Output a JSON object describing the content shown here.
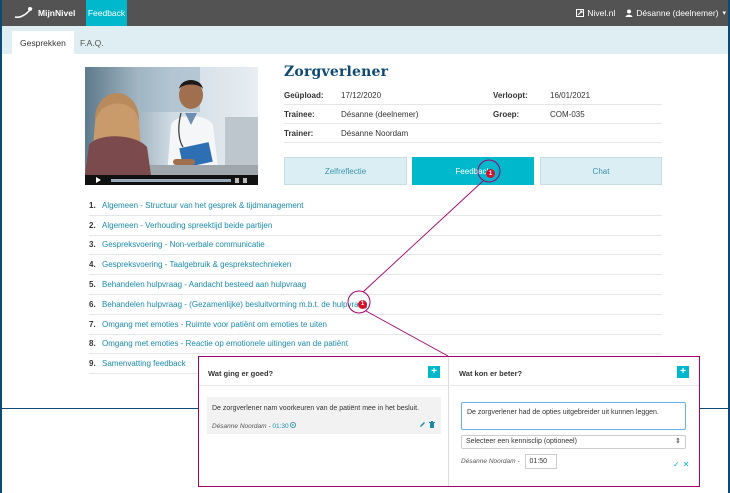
{
  "topbar": {
    "app_name": "MijnNivel",
    "active_tab": "Feedback",
    "site_link": "Nivel.nl",
    "user": "Désanne (deelnemer)"
  },
  "subnav": {
    "tabs": [
      "Gesprekken",
      "F.A.Q."
    ]
  },
  "session": {
    "title": "Zorgverlener",
    "upload_label": "Geüpload:",
    "upload_value": "17/12/2020",
    "expires_label": "Verloopt:",
    "expires_value": "16/01/2021",
    "trainee_label": "Trainee:",
    "trainee_value": "Désanne (deelnemer)",
    "group_label": "Groep:",
    "group_value": "COM-035",
    "trainer_label": "Trainer:",
    "trainer_value": "Désanne Noordam"
  },
  "sections": {
    "zelf": "Zelfreflectie",
    "feedback": "Feedback",
    "feedback_count": "1",
    "chat": "Chat"
  },
  "feedback_items": [
    {
      "num": "1.",
      "text": "Algemeen - Structuur van het gesprek & tijdmanagement"
    },
    {
      "num": "2.",
      "text": "Algemeen - Verhouding spreektijd beide partijen"
    },
    {
      "num": "3.",
      "text": "Gespreksvoering - Non-verbale communicatie"
    },
    {
      "num": "4.",
      "text": "Gespreksvoering - Taalgebruik & gesprekstechnieken"
    },
    {
      "num": "5.",
      "text": "Behandelen hulpvraag - Aandacht besteed aan hulpvraag"
    },
    {
      "num": "6.",
      "text": "Behandelen hulpvraag - (Gezamenlijke) besluitvorming m.b.t. de hulpvraag",
      "badge": "1"
    },
    {
      "num": "7.",
      "text": "Omgang met emoties - Ruimte voor patiënt om emoties te uiten"
    },
    {
      "num": "8.",
      "text": "Omgang met emoties - Reactie op emotionele uitingen van de patiënt"
    },
    {
      "num": "9.",
      "text": "Samenvatting feedback"
    }
  ],
  "popup": {
    "left_title": "Wat ging er goed?",
    "right_title": "Wat kon er beter?",
    "plus": "+",
    "good_comment": "De zorgverlener nam voorkeuren van de patiënt mee in het besluit.",
    "good_author": "Désanne Noordam",
    "good_time": "01:30",
    "better_input": "De zorgverlener had de opties uitgebreider uit kunnen leggen.",
    "clip_select": "Selecteer een kennisclip (optioneel)",
    "edit_author": "Désanne Noordam -",
    "edit_time": "01:50"
  },
  "colors": {
    "accent": "#00b8cc",
    "title": "#0c4a75",
    "link": "#1a8aad",
    "badge": "#d8102a",
    "callout": "#a8006b"
  }
}
